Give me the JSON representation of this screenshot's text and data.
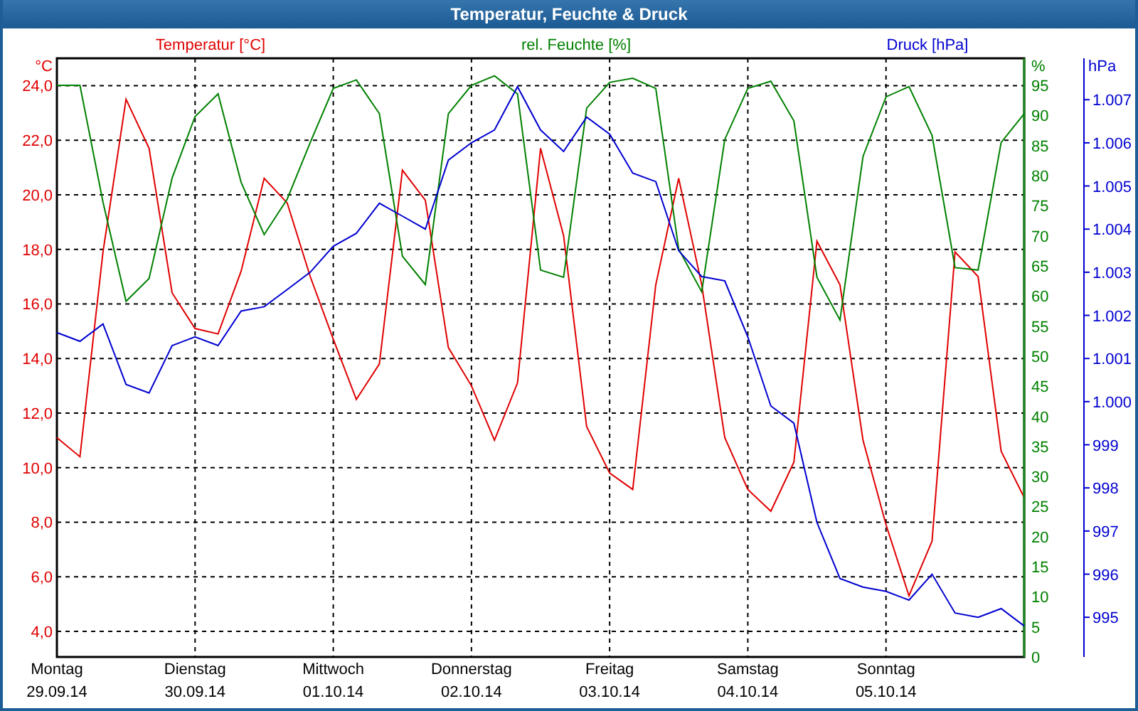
{
  "window": {
    "title": "Temperatur, Feuchte & Druck"
  },
  "charts": [
    {
      "chart_data": {
        "type": "line",
        "title": "Temperatur [°C]",
        "ylabel": "°C",
        "ylim": [
          3.06,
          25
        ],
        "grid": true,
        "categories": [
          "Montag 29.09.14",
          null,
          null,
          null,
          null,
          null,
          "Dienstag 30.09.14",
          null,
          null,
          null,
          null,
          null,
          "Mittwoch 01.10.14",
          null,
          null,
          null,
          null,
          null,
          "Donnerstag 02.10.14",
          null,
          null,
          null,
          null,
          null,
          "Freitag 03.10.14",
          null,
          null,
          null,
          null,
          null,
          "Samstag 04.10.14",
          null,
          null,
          null,
          null,
          null,
          "Sonntag 05.10.14",
          null,
          null,
          null,
          null,
          null,
          null
        ],
        "yticks": [
          {
            "value": 24,
            "label": "24,0"
          },
          {
            "value": 22,
            "label": "22,0"
          },
          {
            "value": 20,
            "label": "20,0"
          },
          {
            "value": 18,
            "label": "18,0"
          },
          {
            "value": 16,
            "label": "16,0"
          },
          {
            "value": 14,
            "label": "14,0"
          },
          {
            "value": 12,
            "label": "12,0"
          },
          {
            "value": 10,
            "label": "10,0"
          },
          {
            "value": 8,
            "label": "8,0"
          },
          {
            "value": 6,
            "label": "6,0"
          },
          {
            "value": 4,
            "label": "4,0"
          }
        ],
        "series": [
          {
            "color": "#e00000",
            "values": [
              11.1,
              10.4,
              17.9,
              23.5,
              21.7,
              16.4,
              15.1,
              14.9,
              17.2,
              20.6,
              19.7,
              17.0,
              14.7,
              12.5,
              13.8,
              20.9,
              19.8,
              14.4,
              13.0,
              11.0,
              13.1,
              21.7,
              18.5,
              11.5,
              9.8,
              9.2,
              16.7,
              20.6,
              16.7,
              11.1,
              9.2,
              8.4,
              10.2,
              18.3,
              16.7,
              11.0,
              7.9,
              5.3,
              7.3,
              17.9,
              17.0,
              10.6,
              8.9
            ]
          }
        ]
      }
    },
    {
      "chart_data": {
        "type": "line",
        "title": "rel. Feuchte [%]",
        "ylabel": "%",
        "ylim": [
          0,
          99.5
        ],
        "yticks": [
          {
            "value": 95,
            "label": "95"
          },
          {
            "value": 90,
            "label": "90"
          },
          {
            "value": 85,
            "label": "85"
          },
          {
            "value": 80,
            "label": "80"
          },
          {
            "value": 75,
            "label": "75"
          },
          {
            "value": 70,
            "label": "70"
          },
          {
            "value": 65,
            "label": "65"
          },
          {
            "value": 60,
            "label": "60"
          },
          {
            "value": 55,
            "label": "55"
          },
          {
            "value": 50,
            "label": "50"
          },
          {
            "value": 45,
            "label": "45"
          },
          {
            "value": 40,
            "label": "40"
          },
          {
            "value": 35,
            "label": "35"
          },
          {
            "value": 30,
            "label": "30"
          },
          {
            "value": 25,
            "label": "25"
          },
          {
            "value": 20,
            "label": "20"
          },
          {
            "value": 15,
            "label": "15"
          },
          {
            "value": 10,
            "label": "10"
          },
          {
            "value": 5,
            "label": "5"
          },
          {
            "value": 0,
            "label": "0"
          }
        ],
        "series": [
          {
            "color": "#008000",
            "values": [
              95.0,
              95.0,
              75.6,
              59.1,
              62.9,
              79.6,
              89.8,
              93.6,
              78.9,
              70.2,
              76.1,
              85.5,
              94.5,
              95.9,
              90.3,
              66.6,
              61.9,
              90.3,
              95.0,
              96.6,
              93.6,
              64.3,
              63.1,
              91.2,
              95.5,
              96.2,
              94.5,
              67.8,
              60.7,
              86.0,
              94.5,
              95.7,
              89.1,
              63.1,
              56.0,
              83.2,
              93.1,
              94.8,
              86.7,
              64.7,
              64.3,
              85.5,
              90.3
            ]
          }
        ]
      }
    },
    {
      "chart_data": {
        "type": "line",
        "title": "Druck [hPa]",
        "ylabel": "hPa",
        "ylim": [
          994.08,
          1007.96
        ],
        "yticks": [
          {
            "value": 1007,
            "label": "1.007"
          },
          {
            "value": 1006,
            "label": "1.006"
          },
          {
            "value": 1005,
            "label": "1.005"
          },
          {
            "value": 1004,
            "label": "1.004"
          },
          {
            "value": 1003,
            "label": "1.003"
          },
          {
            "value": 1002,
            "label": "1.002"
          },
          {
            "value": 1001,
            "label": "1.001"
          },
          {
            "value": 1000,
            "label": "1.000"
          },
          {
            "value": 999,
            "label": "999"
          },
          {
            "value": 998,
            "label": "998"
          },
          {
            "value": 997,
            "label": "997"
          },
          {
            "value": 996,
            "label": "996"
          },
          {
            "value": 995,
            "label": "995"
          }
        ],
        "series": [
          {
            "color": "#0000d0",
            "values": [
              1001.6,
              1001.4,
              1001.8,
              1000.4,
              1000.2,
              1001.3,
              1001.5,
              1001.3,
              1002.1,
              1002.2,
              1002.6,
              1003.0,
              1003.6,
              1003.9,
              1004.6,
              1004.3,
              1004.0,
              1005.6,
              1006.0,
              1006.3,
              1007.3,
              1006.3,
              1005.8,
              1006.6,
              1006.2,
              1005.3,
              1005.1,
              1003.5,
              1002.9,
              1002.8,
              1001.5,
              999.9,
              999.5,
              997.2,
              995.9,
              995.7,
              995.6,
              995.4,
              996.0,
              995.1,
              995.0,
              995.2,
              994.8
            ]
          }
        ]
      }
    }
  ]
}
